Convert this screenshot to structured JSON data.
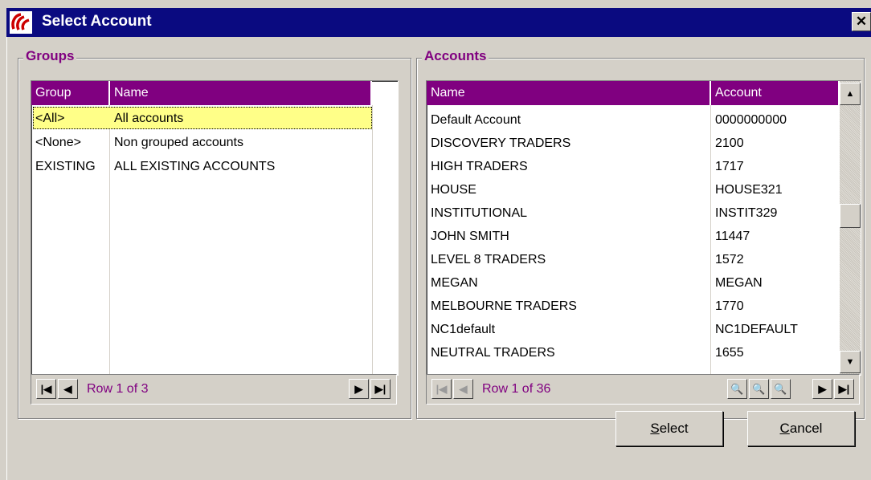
{
  "window": {
    "title": "Select Account",
    "close_label": "✕"
  },
  "groups": {
    "label": "Groups",
    "columns": [
      "Group",
      "Name"
    ],
    "rows": [
      {
        "group": "<All>",
        "name": "All accounts"
      },
      {
        "group": "<None>",
        "name": "Non grouped accounts"
      },
      {
        "group": "EXISTING",
        "name": "ALL EXISTING ACCOUNTS"
      }
    ],
    "nav_text": "Row 1 of 3"
  },
  "accounts": {
    "label": "Accounts",
    "columns": [
      "Name",
      "Account"
    ],
    "rows": [
      {
        "name": "Default Account",
        "account": "0000000000"
      },
      {
        "name": "DISCOVERY TRADERS",
        "account": "2100"
      },
      {
        "name": "HIGH TRADERS",
        "account": "1717"
      },
      {
        "name": "HOUSE",
        "account": "HOUSE321"
      },
      {
        "name": "INSTITUTIONAL",
        "account": "INSTIT329"
      },
      {
        "name": "JOHN SMITH",
        "account": "11447"
      },
      {
        "name": "LEVEL 8 TRADERS",
        "account": "1572"
      },
      {
        "name": "MEGAN",
        "account": "MEGAN"
      },
      {
        "name": "MELBOURNE TRADERS",
        "account": "1770"
      },
      {
        "name": "NC1default",
        "account": "NC1DEFAULT"
      },
      {
        "name": "NEUTRAL TRADERS",
        "account": "1655"
      }
    ],
    "nav_text": "Row 1 of 36"
  },
  "buttons": {
    "select_ul": "S",
    "select_rest": "elect",
    "cancel_ul": "C",
    "cancel_rest": "ancel"
  },
  "icons": {
    "first": "|◀",
    "prev": "◀",
    "next": "▶",
    "last": "▶|",
    "find": "🔍",
    "find_prev": "🔍",
    "find_next": "🔍",
    "up": "▲",
    "down": "▼"
  },
  "colors": {
    "accent": "#800080",
    "titlebar": "#0a0a80",
    "selection": "#ffff88"
  }
}
